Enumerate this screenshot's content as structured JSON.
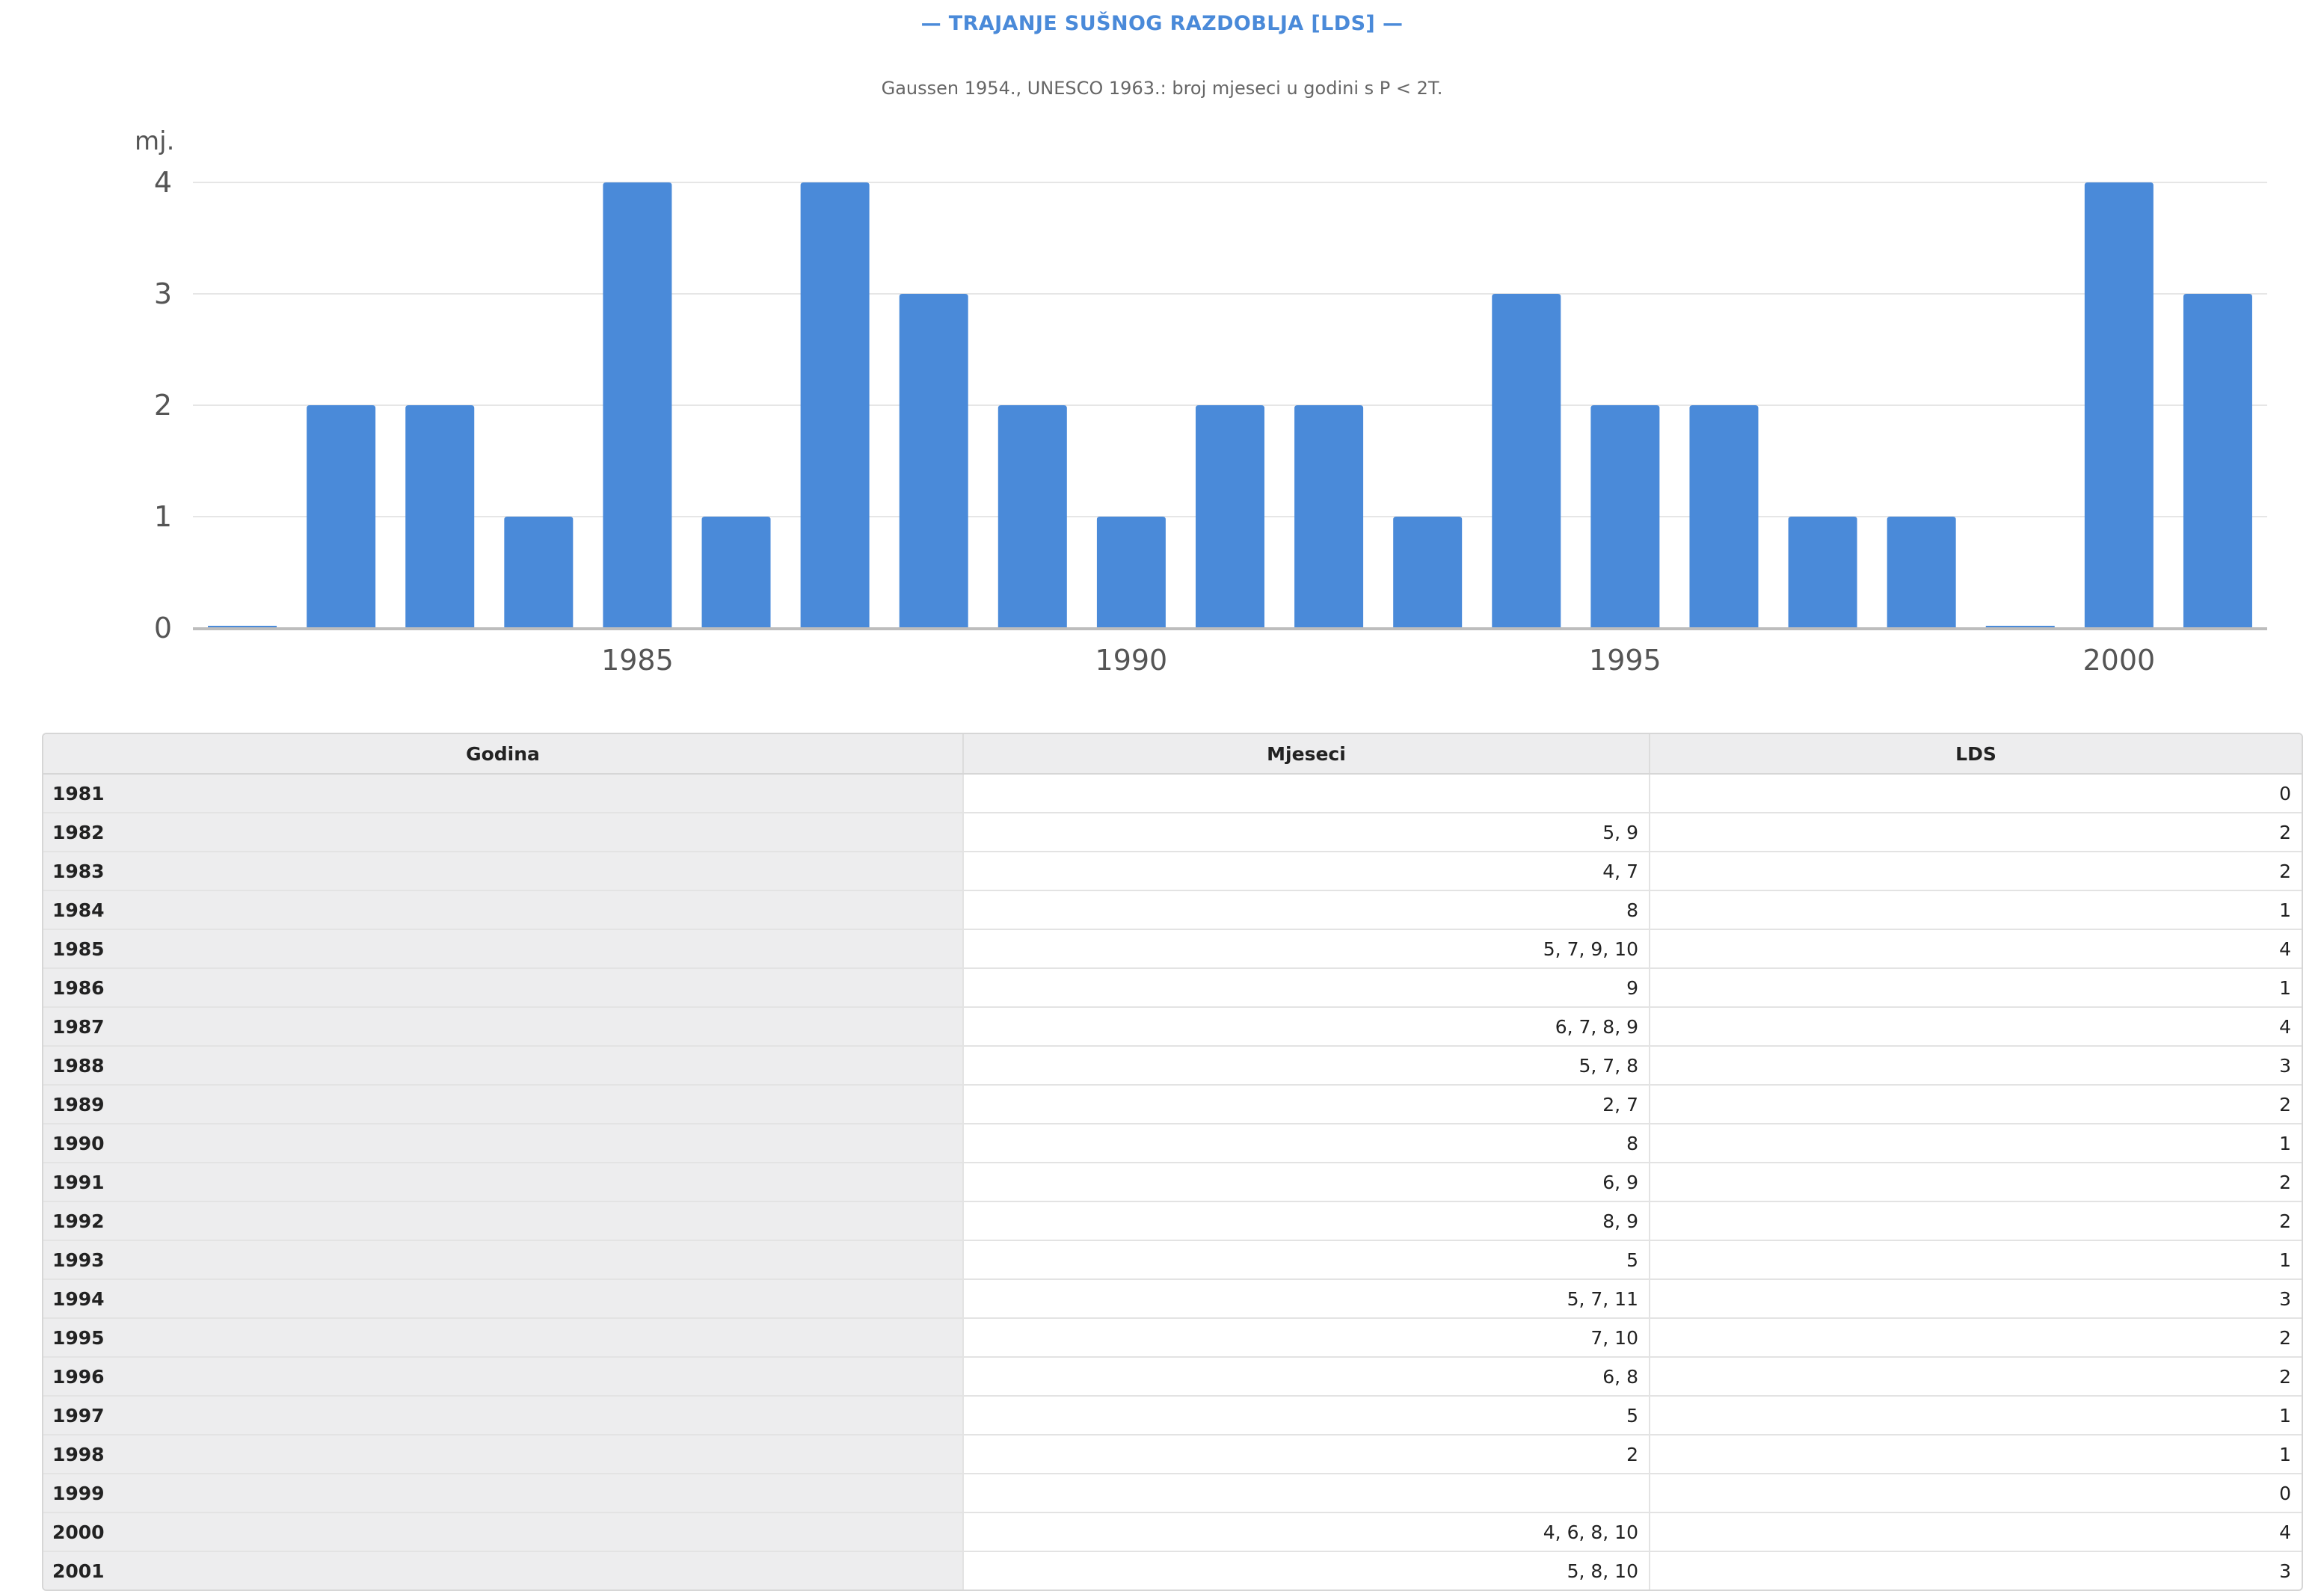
{
  "header": {
    "title": "— TRAJANJE SUŠNOG RAZDOBLJA [LDS] —",
    "subtitle": "Gaussen 1954., UNESCO 1963.: broj mjeseci u godini s P < 2T."
  },
  "chart_data": {
    "type": "bar",
    "ylabel": "mj.",
    "ylim": [
      0,
      4
    ],
    "yticks": [
      0,
      1,
      2,
      3,
      4
    ],
    "xticks": [
      1985,
      1990,
      1995,
      2000
    ],
    "grid": true,
    "color": "#4a8ad9",
    "categories": [
      1981,
      1982,
      1983,
      1984,
      1985,
      1986,
      1987,
      1988,
      1989,
      1990,
      1991,
      1992,
      1993,
      1994,
      1995,
      1996,
      1997,
      1998,
      1999,
      2000,
      2001
    ],
    "values": [
      0,
      2,
      2,
      1,
      4,
      1,
      4,
      3,
      2,
      1,
      2,
      2,
      1,
      3,
      2,
      2,
      1,
      1,
      0,
      4,
      3
    ]
  },
  "table": {
    "headers": [
      "Godina",
      "Mjeseci",
      "LDS"
    ],
    "rows": [
      [
        "1981",
        "",
        "0"
      ],
      [
        "1982",
        "5, 9",
        "2"
      ],
      [
        "1983",
        "4, 7",
        "2"
      ],
      [
        "1984",
        "8",
        "1"
      ],
      [
        "1985",
        "5, 7, 9, 10",
        "4"
      ],
      [
        "1986",
        "9",
        "1"
      ],
      [
        "1987",
        "6, 7, 8, 9",
        "4"
      ],
      [
        "1988",
        "5, 7, 8",
        "3"
      ],
      [
        "1989",
        "2, 7",
        "2"
      ],
      [
        "1990",
        "8",
        "1"
      ],
      [
        "1991",
        "6, 9",
        "2"
      ],
      [
        "1992",
        "8, 9",
        "2"
      ],
      [
        "1993",
        "5",
        "1"
      ],
      [
        "1994",
        "5, 7, 11",
        "3"
      ],
      [
        "1995",
        "7, 10",
        "2"
      ],
      [
        "1996",
        "6, 8",
        "2"
      ],
      [
        "1997",
        "5",
        "1"
      ],
      [
        "1998",
        "2",
        "1"
      ],
      [
        "1999",
        "",
        "0"
      ],
      [
        "2000",
        "4, 6, 8, 10",
        "4"
      ],
      [
        "2001",
        "5, 8, 10",
        "3"
      ]
    ]
  }
}
